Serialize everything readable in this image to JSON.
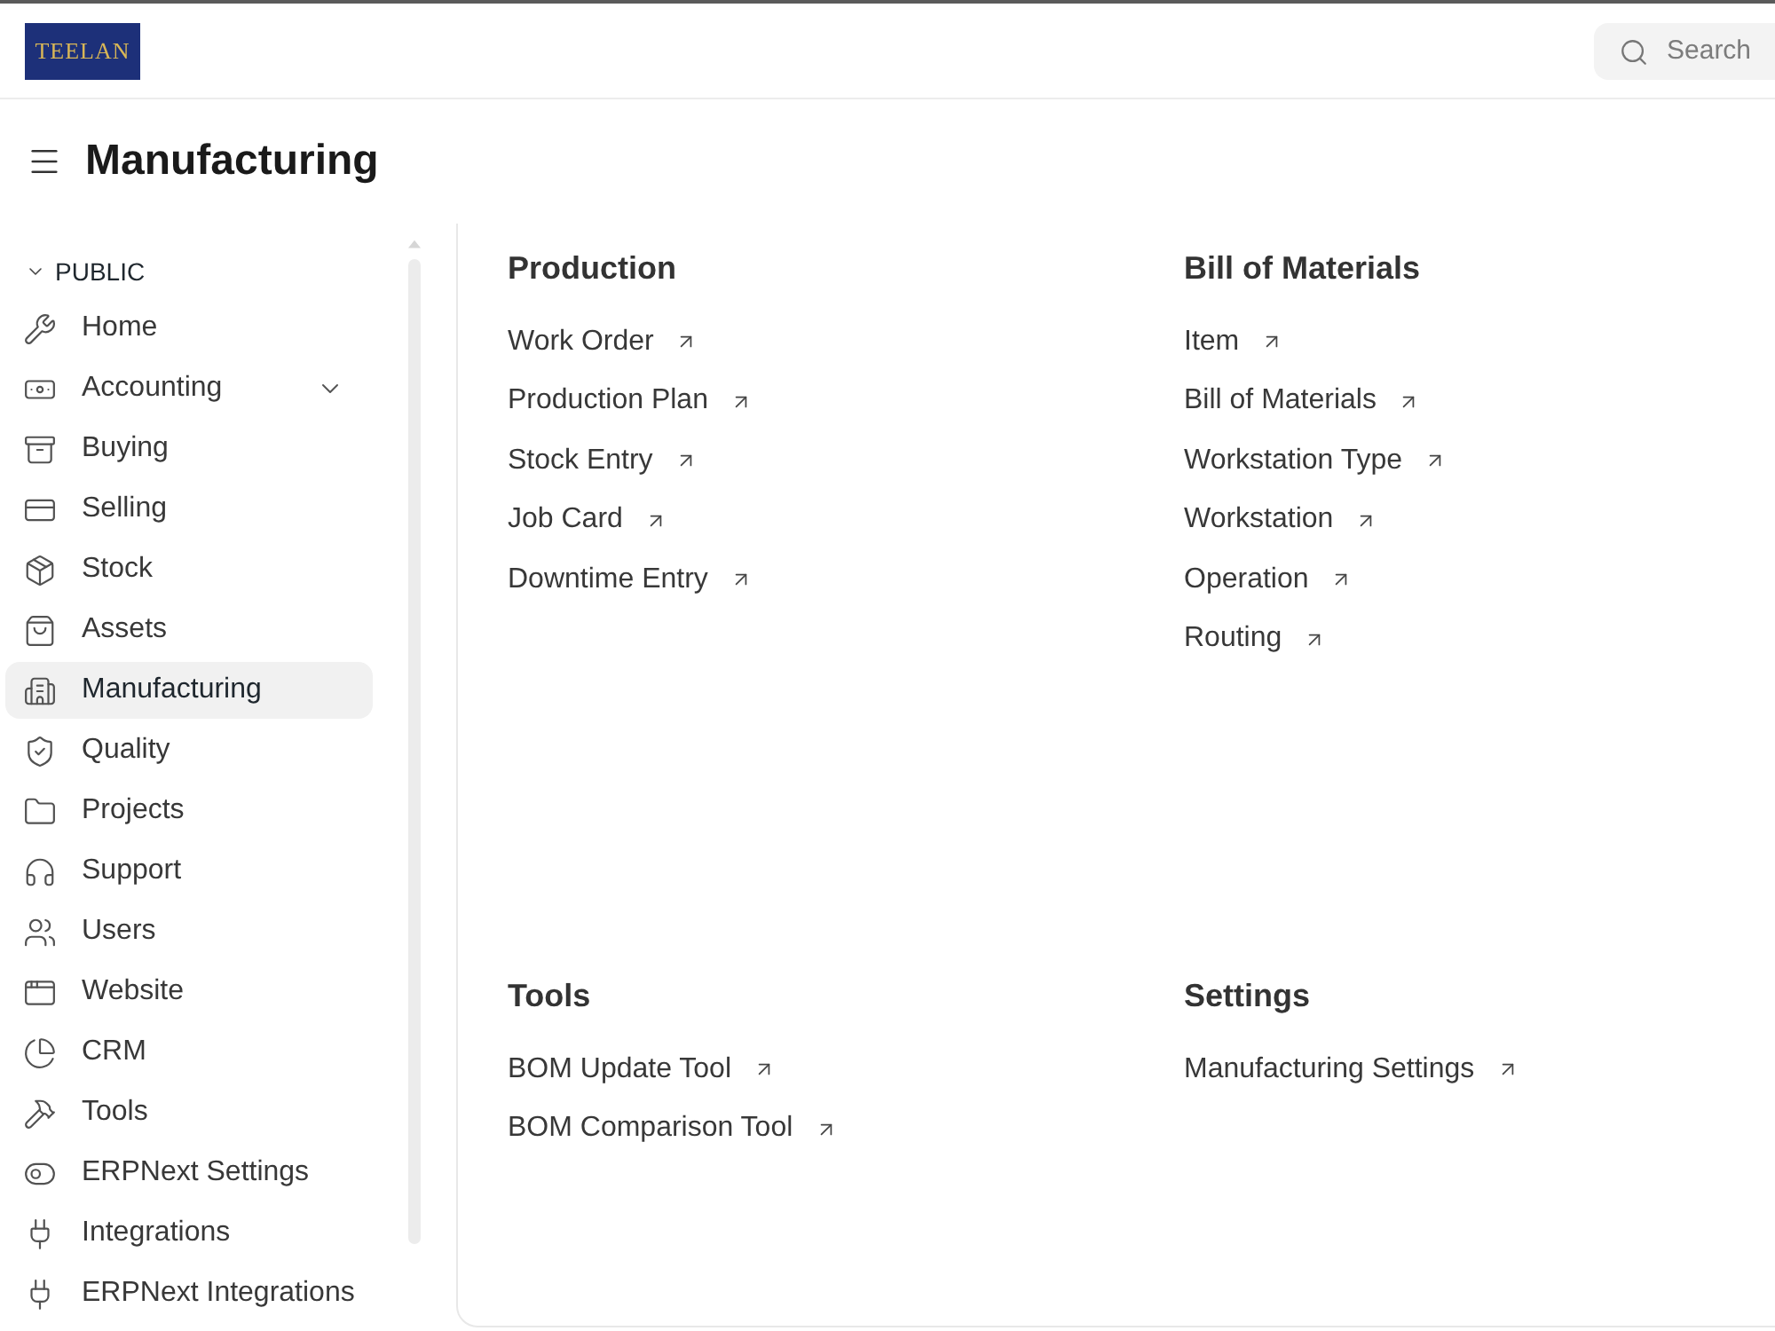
{
  "header": {
    "logo": {
      "text": "TEELAN"
    },
    "search": {
      "placeholder": "Search"
    }
  },
  "page": {
    "title": "Manufacturing"
  },
  "sidebar": {
    "section": {
      "label": "PUBLIC",
      "expanded": true
    },
    "items": [
      {
        "label": "Home",
        "kind": "link",
        "selected": false
      },
      {
        "label": "Accounting",
        "kind": "group",
        "selected": false
      },
      {
        "label": "Buying",
        "kind": "link",
        "selected": false
      },
      {
        "label": "Selling",
        "kind": "link",
        "selected": false
      },
      {
        "label": "Stock",
        "kind": "link",
        "selected": false
      },
      {
        "label": "Assets",
        "kind": "link",
        "selected": false
      },
      {
        "label": "Manufacturing",
        "kind": "link",
        "selected": true
      },
      {
        "label": "Quality",
        "kind": "link",
        "selected": false
      },
      {
        "label": "Projects",
        "kind": "link",
        "selected": false
      },
      {
        "label": "Support",
        "kind": "link",
        "selected": false
      },
      {
        "label": "Users",
        "kind": "link",
        "selected": false
      },
      {
        "label": "Website",
        "kind": "link",
        "selected": false
      },
      {
        "label": "CRM",
        "kind": "link",
        "selected": false
      },
      {
        "label": "Tools",
        "kind": "link",
        "selected": false
      },
      {
        "label": "ERPNext Settings",
        "kind": "link",
        "selected": false
      },
      {
        "label": "Integrations",
        "kind": "link",
        "selected": false
      },
      {
        "label": "ERPNext Integrations",
        "kind": "link",
        "selected": false
      }
    ]
  },
  "workspace": {
    "sections": [
      {
        "title": "Production",
        "links": [
          "Work Order",
          "Production Plan",
          "Stock Entry",
          "Job Card",
          "Downtime Entry"
        ]
      },
      {
        "title": "Bill of Materials",
        "links": [
          "Item",
          "Bill of Materials",
          "Workstation Type",
          "Workstation",
          "Operation",
          "Routing"
        ]
      },
      {
        "title": "Tools",
        "links": [
          "BOM Update Tool",
          "BOM Comparison Tool"
        ]
      },
      {
        "title": "Settings",
        "links": [
          "Manufacturing Settings"
        ]
      }
    ]
  }
}
